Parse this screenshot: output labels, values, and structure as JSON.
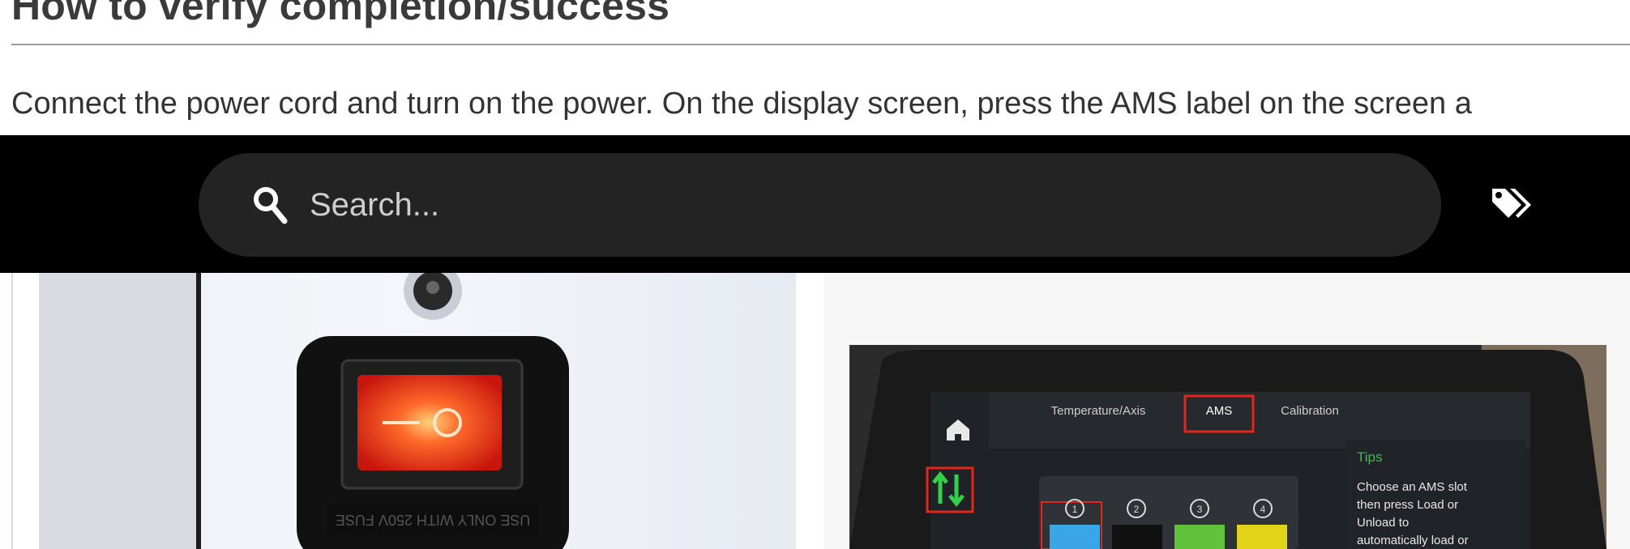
{
  "section": {
    "title": "How to verify completion/success",
    "intro": "Connect the power cord and turn on the power. On the display screen, press the AMS label on the screen a"
  },
  "topbar": {
    "search_placeholder": "Search...",
    "search_icon": "search-icon",
    "tags_icon": "tags-icon"
  },
  "photos": {
    "left": {
      "switch_marking": "USE ONLY WITH 250V FUSE"
    },
    "right": {
      "tabs": [
        "Temperature/Axis",
        "AMS",
        "Calibration"
      ],
      "tips_title": "Tips",
      "tips_lines": [
        "Choose an AMS slot",
        "then press Load or",
        "Unload to",
        "automatically load or"
      ],
      "slot_numbers": [
        "1",
        "2",
        "3",
        "4"
      ],
      "slot_colors": [
        "#3aa6e8",
        "#111111",
        "#5fc23a",
        "#e3d21a"
      ]
    }
  }
}
